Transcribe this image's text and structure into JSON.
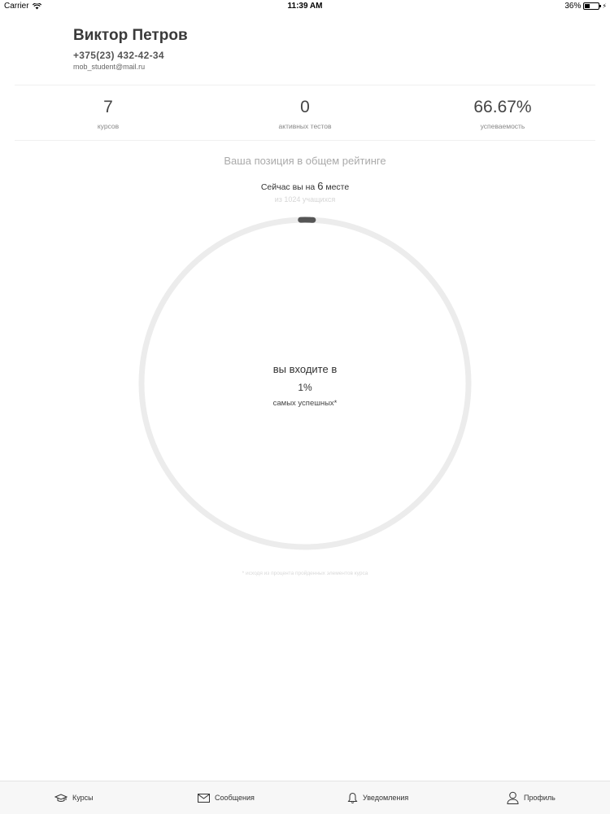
{
  "status_bar": {
    "carrier": "Carrier",
    "time": "11:39 AM",
    "battery": "36%",
    "battery_level": 0.36
  },
  "profile": {
    "name": "Виктор Петров",
    "phone": "+375(23) 432-42-34",
    "email": "mob_student@mail.ru"
  },
  "stats": [
    {
      "value": "7",
      "label": "курсов"
    },
    {
      "value": "0",
      "label": "активных тестов"
    },
    {
      "value": "66.67%",
      "label": "успеваемость"
    }
  ],
  "rating": {
    "title": "Ваша позиция в общем рейтинге",
    "now_prefix": "Сейчас вы на",
    "place": "6",
    "now_suffix": "месте",
    "of_total": "из 1024 учащихся",
    "center_line1": "вы входите в",
    "percent": "1%",
    "center_line3": "самых успешных*",
    "progress_fraction": 0.01,
    "footnote": "* исходя из процента пройденных элементов курса"
  },
  "tabs": [
    {
      "label": "Курсы",
      "icon": "graduation-cap-icon"
    },
    {
      "label": "Сообщения",
      "icon": "envelope-icon"
    },
    {
      "label": "Уведомления",
      "icon": "bell-icon"
    },
    {
      "label": "Профиль",
      "icon": "person-icon"
    }
  ],
  "colors": {
    "ring_track": "#ececec",
    "ring_progress": "#555555",
    "text_primary": "#333333",
    "text_muted": "#aaaaaa"
  }
}
